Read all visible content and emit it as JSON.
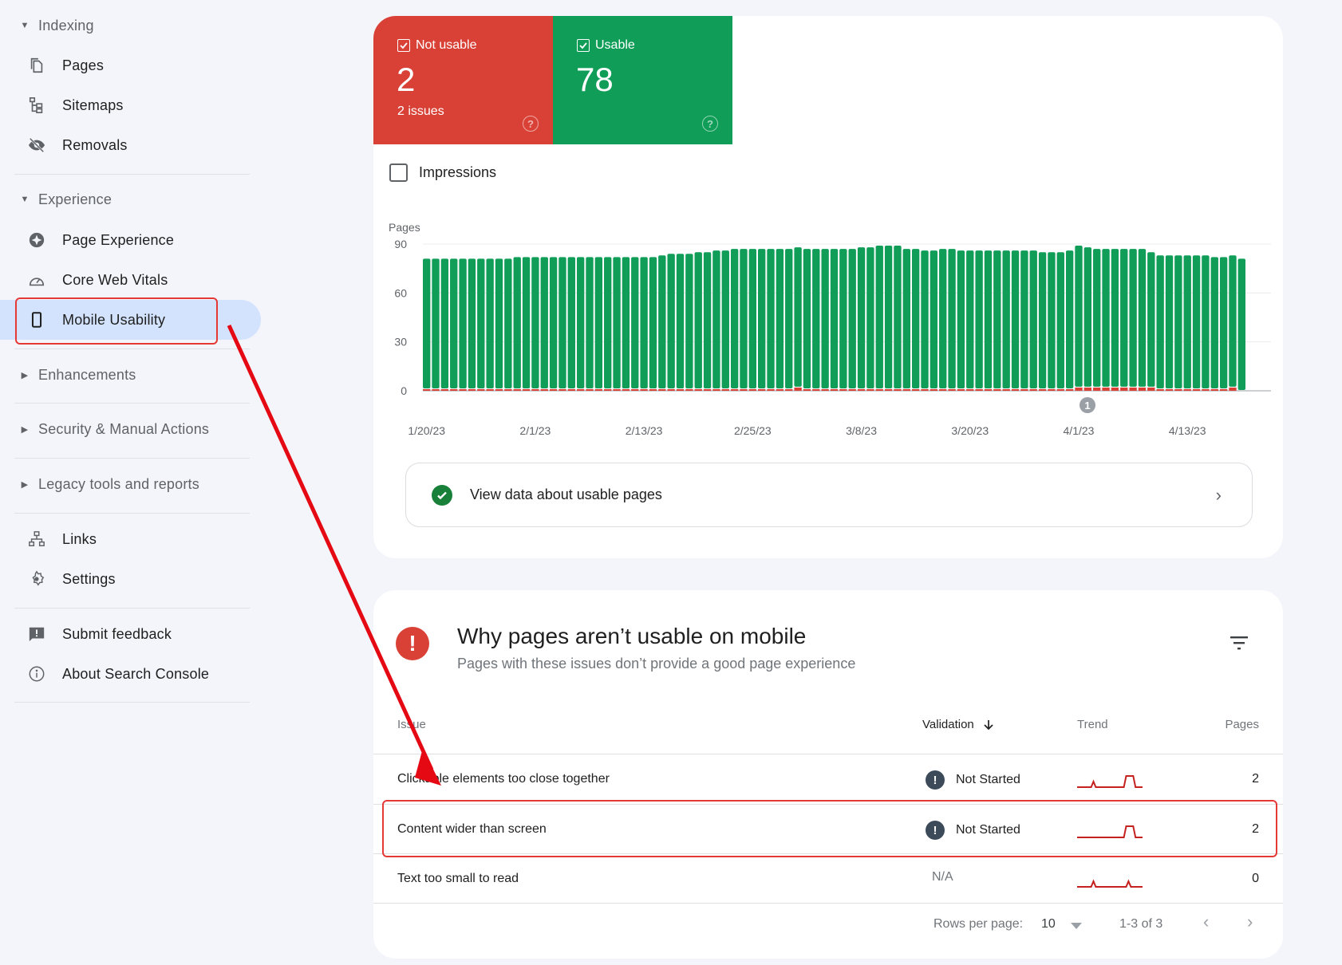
{
  "sidebar": {
    "sections": [
      {
        "label": "Indexing",
        "expanded": true
      },
      {
        "label": "Experience",
        "expanded": true
      },
      {
        "label": "Enhancements",
        "expanded": false
      },
      {
        "label": "Security & Manual Actions",
        "expanded": false
      },
      {
        "label": "Legacy tools and reports",
        "expanded": false
      }
    ],
    "items": [
      {
        "label": "Pages",
        "icon": "pages-icon"
      },
      {
        "label": "Sitemaps",
        "icon": "sitemaps-icon"
      },
      {
        "label": "Removals",
        "icon": "removals-icon"
      },
      {
        "label": "Page Experience",
        "icon": "page-experience-icon"
      },
      {
        "label": "Core Web Vitals",
        "icon": "core-web-vitals-icon"
      },
      {
        "label": "Mobile Usability",
        "icon": "mobile-icon",
        "active": true
      },
      {
        "label": "Links",
        "icon": "links-icon"
      },
      {
        "label": "Settings",
        "icon": "settings-icon"
      },
      {
        "label": "Submit feedback",
        "icon": "feedback-icon"
      },
      {
        "label": "About Search Console",
        "icon": "info-icon"
      }
    ]
  },
  "summary": {
    "not_usable": {
      "label": "Not usable",
      "value": "2",
      "sub": "2 issues",
      "checked": true,
      "color": "#d94136"
    },
    "usable": {
      "label": "Usable",
      "value": "78",
      "checked": true,
      "color": "#0f9d58"
    },
    "impressions_label": "Impressions"
  },
  "chart_data": {
    "type": "bar",
    "stacked": true,
    "ylabel": "Pages",
    "ylim": [
      0,
      90
    ],
    "yticks": [
      0,
      30,
      60,
      90
    ],
    "x_tick_labels": [
      "1/20/23",
      "2/1/23",
      "2/13/23",
      "2/25/23",
      "3/8/23",
      "3/20/23",
      "4/1/23",
      "4/13/23"
    ],
    "start_date": "1/20/23",
    "annotation": {
      "label": "1",
      "date": "4/1/23"
    },
    "series": [
      {
        "name": "Not usable",
        "color": "#d94136",
        "values": [
          1,
          1,
          1,
          1,
          1,
          1,
          1,
          1,
          1,
          1,
          1,
          1,
          1,
          1,
          1,
          1,
          1,
          1,
          1,
          1,
          1,
          1,
          1,
          1,
          1,
          1,
          1,
          1,
          1,
          1,
          1,
          1,
          1,
          1,
          1,
          1,
          1,
          1,
          1,
          1,
          1,
          1,
          1,
          1,
          1,
          1,
          1,
          1,
          1,
          1,
          1,
          1,
          1,
          1,
          1,
          1,
          1,
          1,
          1,
          1,
          1,
          1,
          1,
          1,
          1,
          1,
          1,
          1,
          1,
          1,
          1,
          1,
          1,
          1,
          1,
          1,
          1,
          1,
          1,
          1,
          1,
          1,
          1,
          1,
          1,
          1,
          1,
          1,
          1,
          1
        ]
      },
      {
        "name": "Usable",
        "color": "#0f9d58",
        "values": [
          80,
          80,
          80,
          80,
          80,
          80,
          80,
          80,
          80,
          80,
          81,
          81,
          81,
          81,
          81,
          81,
          81,
          81,
          81,
          81,
          81,
          81,
          81,
          81,
          81,
          81,
          82,
          83,
          83,
          83,
          84,
          84,
          85,
          85,
          86,
          86,
          86,
          86,
          86,
          86,
          86,
          86,
          86,
          86,
          86,
          86,
          86,
          86,
          87,
          87,
          88,
          88,
          88,
          86,
          86,
          85,
          85,
          86,
          86,
          85,
          85,
          85,
          85,
          85,
          85,
          85,
          85,
          85,
          84,
          84,
          84,
          85,
          87,
          86,
          85,
          85,
          85,
          85,
          85,
          85,
          83,
          82,
          82,
          82,
          82,
          82,
          82,
          81,
          81,
          81,
          81
        ]
      }
    ],
    "not_usable_extra": {
      "indices": [
        41,
        72,
        73,
        74,
        75,
        76,
        77,
        78,
        79,
        80,
        89,
        90
      ],
      "value": 2
    }
  },
  "view_usable": {
    "label": "View data about usable pages"
  },
  "issues": {
    "title": "Why pages aren’t usable on mobile",
    "subtitle": "Pages with these issues don’t provide a good page experience",
    "columns": {
      "issue": "Issue",
      "validation": "Validation",
      "trend": "Trend",
      "pages": "Pages"
    },
    "rows": [
      {
        "issue": "Clickable elements too close together",
        "validation": "Not Started",
        "status_icon": "alert-icon",
        "pages": "2",
        "trend": [
          0,
          0,
          0,
          0,
          0,
          0,
          0,
          1,
          0,
          0,
          0,
          0,
          0,
          0,
          0,
          0,
          0,
          0,
          0,
          0,
          0,
          2,
          2,
          2,
          2,
          0,
          0,
          0,
          0
        ]
      },
      {
        "issue": "Content wider than screen",
        "validation": "Not Started",
        "status_icon": "alert-icon",
        "pages": "2",
        "trend": [
          0,
          0,
          0,
          0,
          0,
          0,
          0,
          0,
          0,
          0,
          0,
          0,
          0,
          0,
          0,
          0,
          0,
          0,
          0,
          0,
          0,
          2,
          2,
          2,
          2,
          0,
          0,
          0,
          0
        ]
      },
      {
        "issue": "Text too small to read",
        "validation": "N/A",
        "status_icon": null,
        "pages": "0",
        "trend": [
          0,
          0,
          0,
          0,
          0,
          0,
          0,
          1,
          0,
          0,
          0,
          0,
          0,
          0,
          0,
          0,
          0,
          0,
          0,
          0,
          0,
          0,
          1,
          0,
          0,
          0,
          0,
          0,
          0
        ]
      }
    ],
    "pagination": {
      "rows_per_page_label": "Rows per page:",
      "rows_per_page": "10",
      "range": "1-3 of 3"
    }
  },
  "colors": {
    "accent_active": "#d3e3fd",
    "annotation": "#e53935",
    "trend": "#c5221f"
  }
}
